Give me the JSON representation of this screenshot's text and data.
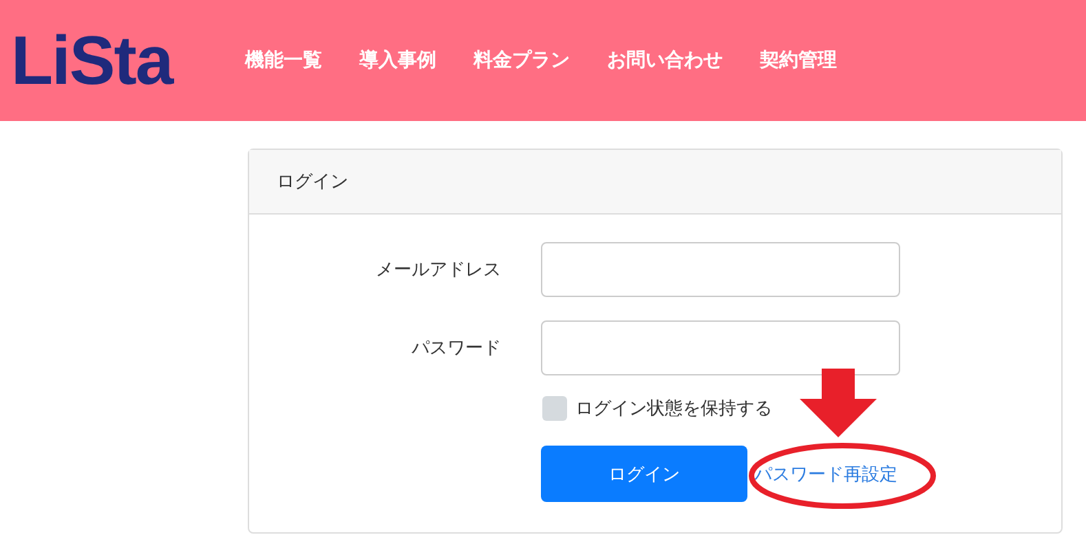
{
  "header": {
    "logo": "LiSta",
    "nav": [
      "機能一覧",
      "導入事例",
      "料金プラン",
      "お問い合わせ",
      "契約管理"
    ]
  },
  "card": {
    "title": "ログイン",
    "fields": [
      {
        "label": "メールアドレス"
      },
      {
        "label": "パスワード"
      }
    ],
    "remember": {
      "label": "ログイン状態を保持する",
      "checked": false
    },
    "submit": "ログイン",
    "reset_link": "パスワード再設定"
  },
  "annotation": {
    "kind": "arrow-ellipse"
  }
}
